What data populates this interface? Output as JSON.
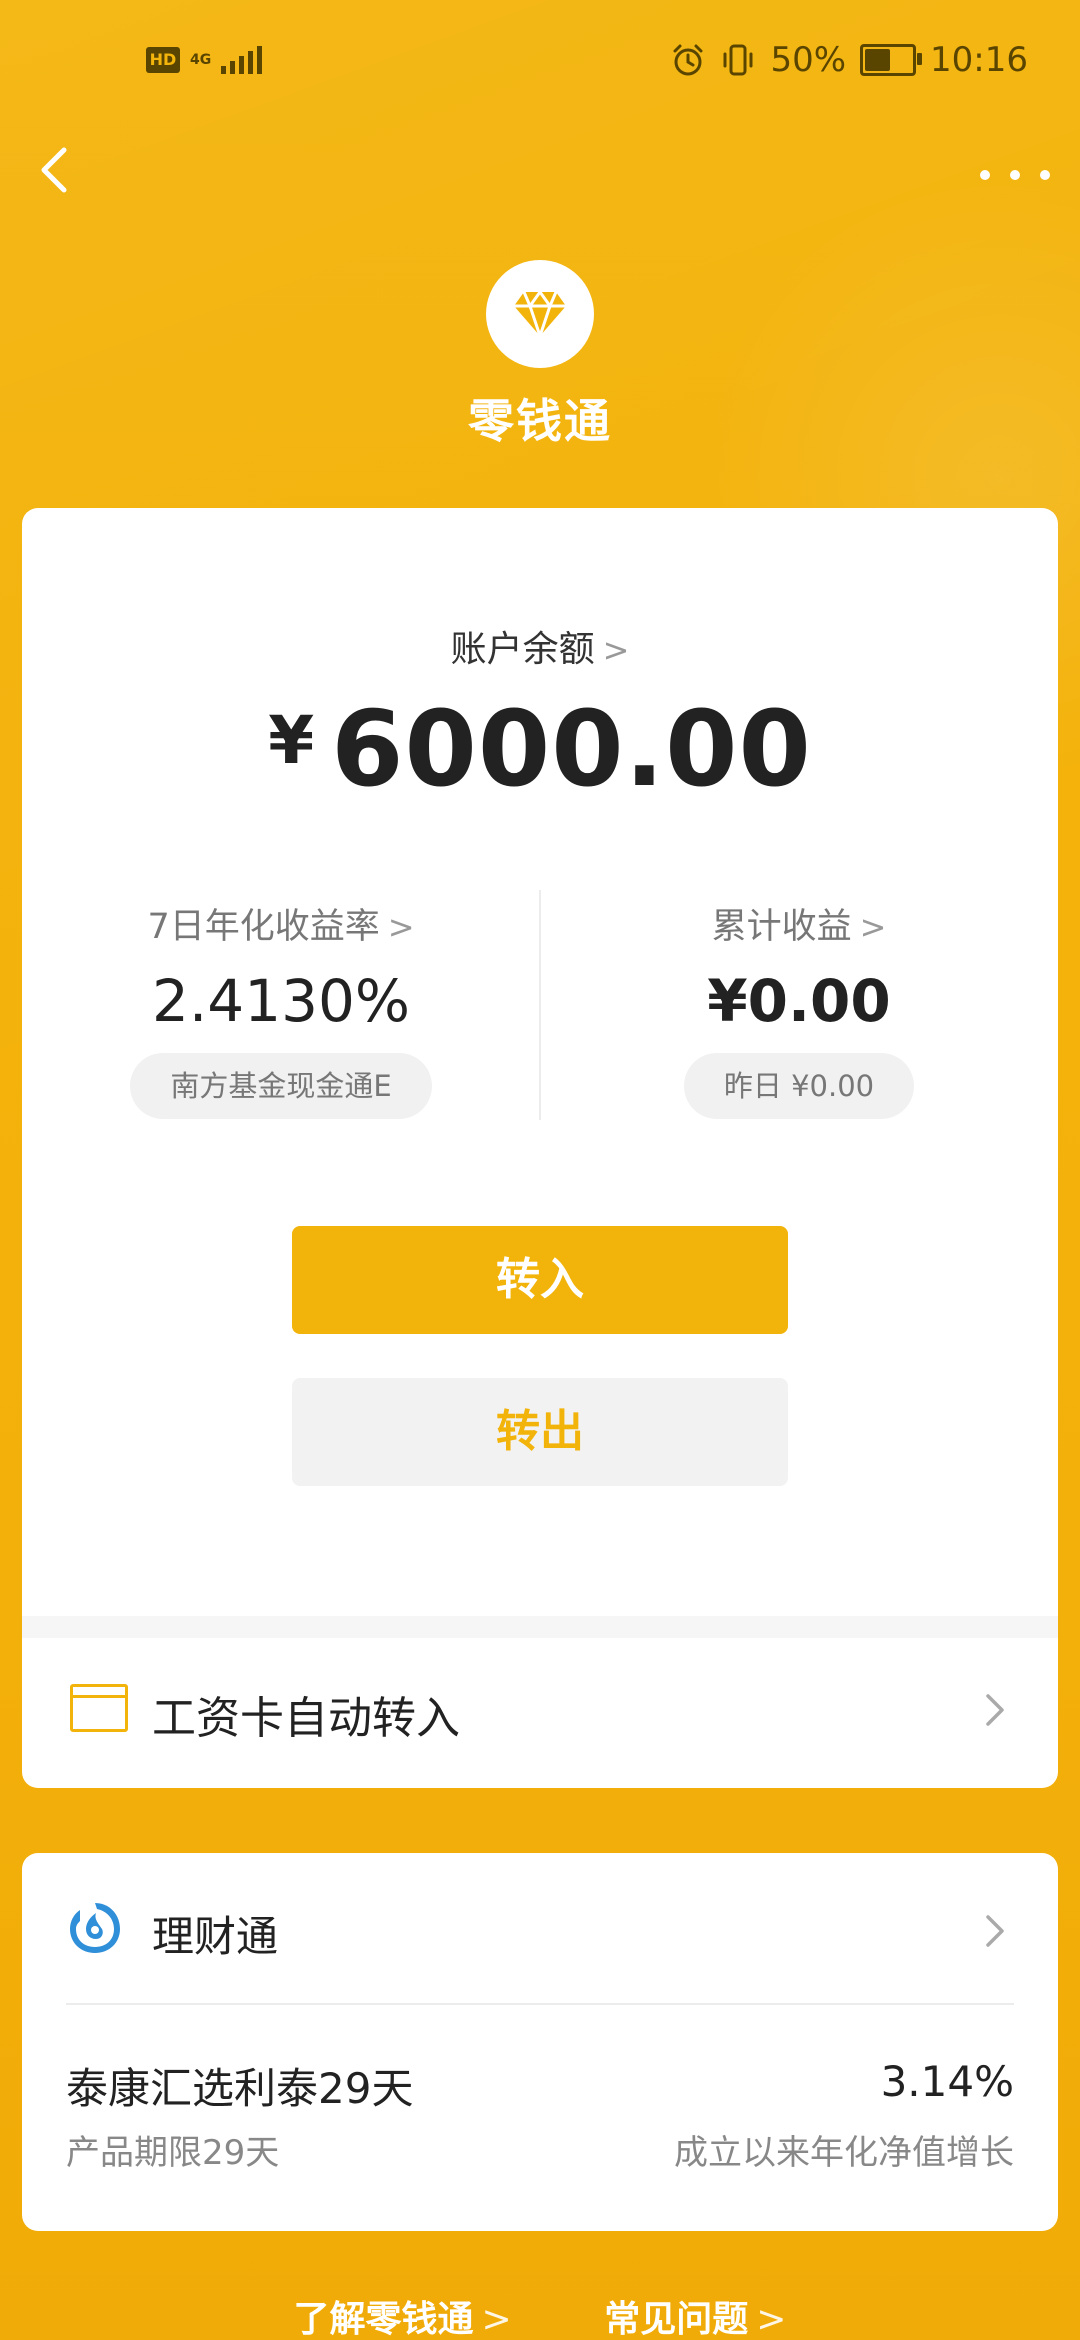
{
  "status_bar": {
    "hd": "HD",
    "network": "4G",
    "battery": "50%",
    "battery_level": 0.5,
    "time": "10:16"
  },
  "nav": {
    "back_icon": "chevron-left-icon",
    "more_icon": "more-horizontal-icon"
  },
  "header": {
    "logo_icon": "diamond-icon",
    "title": "零钱通"
  },
  "account": {
    "balance_label": "账户余额",
    "currency": "¥",
    "balance": "6000.00"
  },
  "stats": {
    "rate_label": "7日年化收益率",
    "rate_value": "2.4130%",
    "fund_pill": "南方基金现金通E",
    "income_label": "累计收益",
    "income_value": "¥0.00",
    "yesterday_pill": "昨日 ¥0.00"
  },
  "actions": {
    "transfer_in": "转入",
    "transfer_out": "转出"
  },
  "salary": {
    "icon": "card-icon",
    "label": "工资卡自动转入"
  },
  "licaitong": {
    "icon": "licaitong-logo-icon",
    "label": "理财通",
    "product_name": "泰康汇选利泰29天",
    "product_rate": "3.14%",
    "product_term": "产品期限29天",
    "product_rate_desc": "成立以来年化净值增长"
  },
  "footer": {
    "learn_more": "了解零钱通",
    "faq": "常见问题"
  },
  "colors": {
    "background": "#f3b40b",
    "accent": "#f2b30a",
    "text_primary": "#222222",
    "text_secondary": "#888888"
  }
}
